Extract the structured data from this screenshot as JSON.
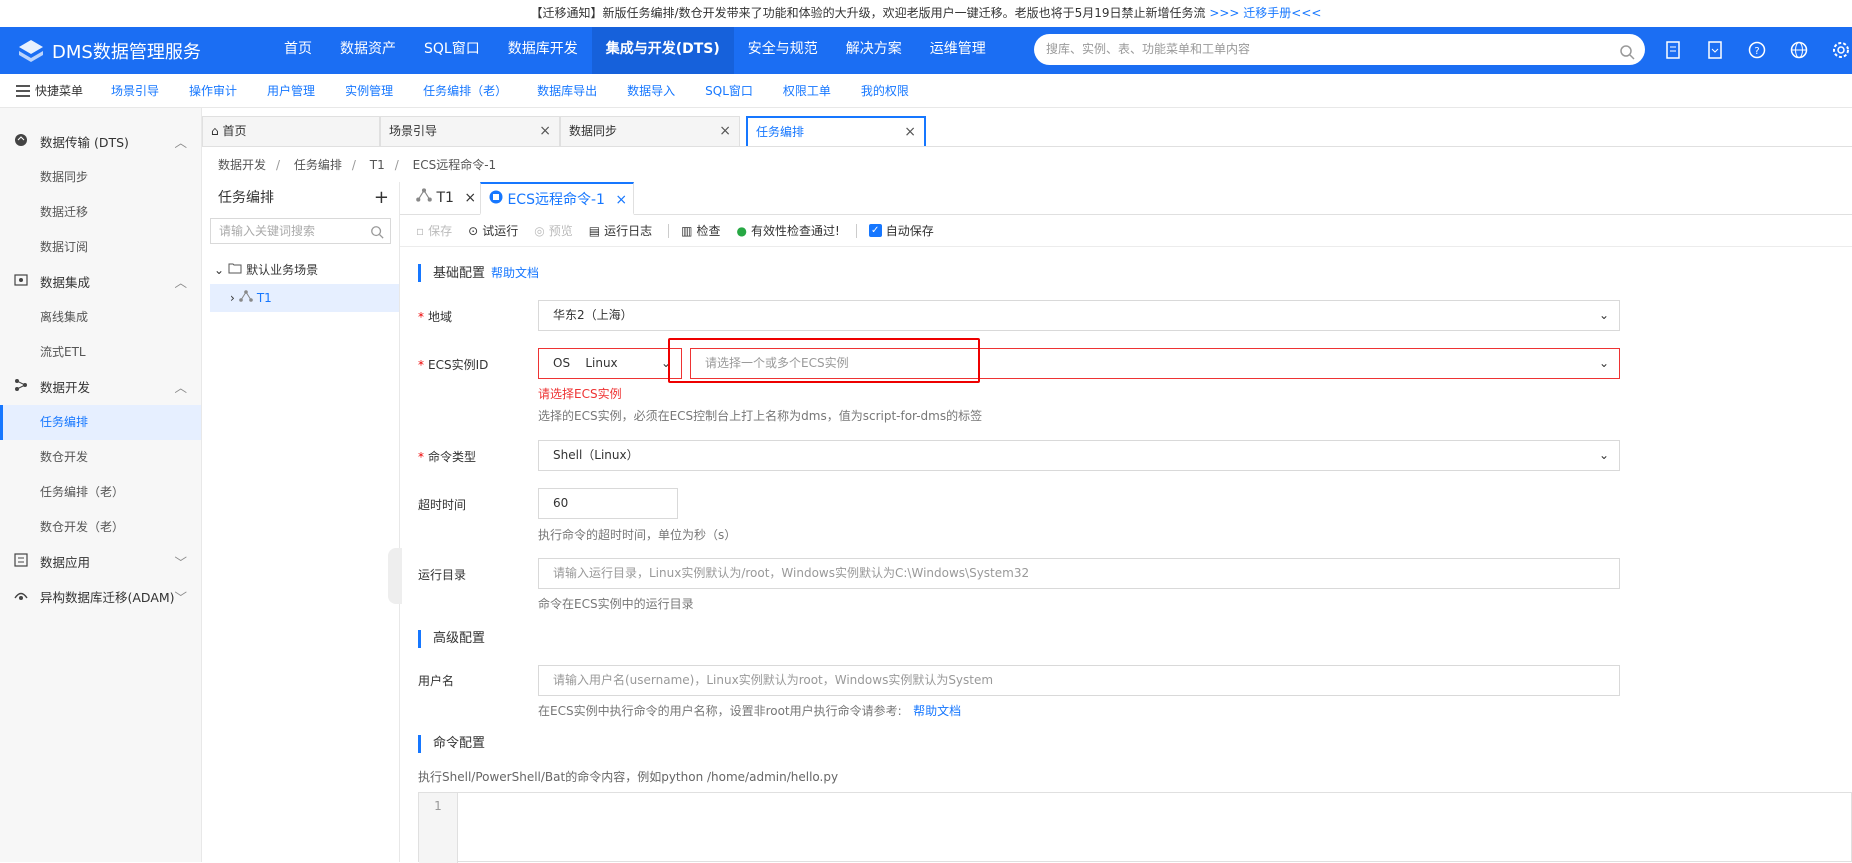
{
  "notice": {
    "text": "【迁移通知】新版任务编排/数仓开发带来了功能和体验的大升级，欢迎老版用户一键迁移。老版也将于5月19日禁止新增任务流 ",
    "link": ">>> 迁移手册<<<"
  },
  "header": {
    "logo_text": "DMS数据管理服务",
    "nav": [
      "首页",
      "数据资产",
      "SQL窗口",
      "数据库开发",
      "集成与开发(DTS)",
      "安全与规范",
      "解决方案",
      "运维管理"
    ],
    "active_nav": "集成与开发(DTS)",
    "search_placeholder": "搜库、实例、表、功能菜单和工单内容"
  },
  "quickbar": {
    "menu_label": "快捷菜单",
    "items": [
      "场景引导",
      "操作审计",
      "用户管理",
      "实例管理",
      "任务编排（老）",
      "数据库导出",
      "数据导入",
      "SQL窗口",
      "权限工单",
      "我的权限"
    ]
  },
  "sidebar": {
    "groups": [
      {
        "label": "数据传输 (DTS)",
        "items": [
          "数据同步",
          "数据迁移",
          "数据订阅"
        ]
      },
      {
        "label": "数据集成",
        "items": [
          "离线集成",
          "流式ETL"
        ]
      },
      {
        "label": "数据开发",
        "items": [
          "任务编排",
          "数仓开发",
          "任务编排（老）",
          "数仓开发（老）"
        ]
      },
      {
        "label": "数据应用",
        "items": []
      },
      {
        "label": "异构数据库迁移(ADAM)",
        "items": []
      }
    ],
    "active_item": "任务编排"
  },
  "page_tabs": [
    "首页",
    "场景引导",
    "数据同步",
    "任务编排"
  ],
  "breadcrumb": [
    "数据开发",
    "任务编排",
    "T1",
    "ECS远程命令-1"
  ],
  "tree": {
    "title": "任务编排",
    "search_placeholder": "请输入关键词搜索",
    "root": "默认业务场景",
    "child": "T1"
  },
  "subtabs": [
    "T1",
    "ECS远程命令-1"
  ],
  "toolbar": {
    "save": "保存",
    "test_run": "试运行",
    "preview": "预览",
    "run_log": "运行日志",
    "check": "检查",
    "valid": "有效性检查通过!",
    "auto_save": "自动保存"
  },
  "form": {
    "basic_title": "基础配置",
    "help_doc": "帮助文档",
    "region_label": "地域",
    "region_value": "华东2（上海）",
    "ecs_label": "ECS实例ID",
    "os_label": "OS",
    "os_value": "Linux",
    "ecs_placeholder": "请选择一个或多个ECS实例",
    "ecs_error": "请选择ECS实例",
    "ecs_hint": "选择的ECS实例，必须在ECS控制台上打上名称为dms，值为script-for-dms的标签",
    "cmd_type_label": "命令类型",
    "cmd_type_value": "Shell（Linux）",
    "timeout_label": "超时时间",
    "timeout_value": "60",
    "timeout_hint": "执行命令的超时时间，单位为秒（s）",
    "dir_label": "运行目录",
    "dir_placeholder": "请输入运行目录，Linux实例默认为/root，Windows实例默认为C:\\Windows\\System32",
    "dir_hint": "命令在ECS实例中的运行目录",
    "adv_title": "高级配置",
    "user_label": "用户名",
    "user_placeholder": "请输入用户名(username)，Linux实例默认为root，Windows实例默认为System",
    "user_hint": "在ECS实例中执行命令的用户名称，设置非root用户执行命令请参考:",
    "user_hint_link": "帮助文档",
    "cmd_title": "命令配置",
    "cmd_hint": "执行Shell/PowerShell/Bat的命令内容，例如python /home/admin/hello.py",
    "line_no": "1"
  },
  "colors": {
    "primary": "#1b6ef3",
    "accent": "#1677ff",
    "error": "#e33333"
  }
}
